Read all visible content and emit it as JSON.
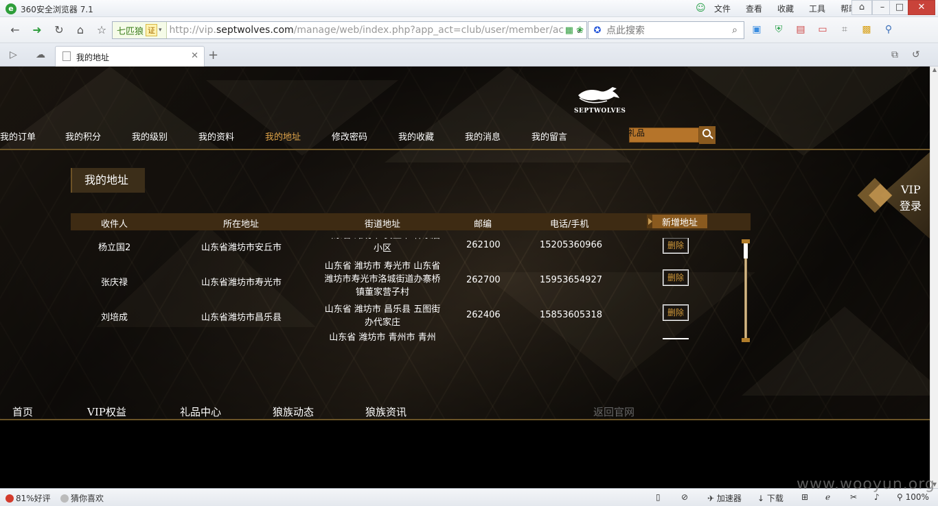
{
  "browser": {
    "title": "360安全浏览器 7.1",
    "menus": [
      "文件",
      "查看",
      "收藏",
      "工具",
      "帮助"
    ],
    "site_badge": "七匹狼",
    "cert_label": "证",
    "url_prefix": "http://vip.",
    "url_host": "septwolves.com",
    "url_path": "/manage/web/index.php?app_act=club/user/member/ac",
    "search_placeholder": "点此搜索",
    "tab_title": "我的地址",
    "icons": [
      "back-icon",
      "forward-icon",
      "refresh-icon",
      "home-icon",
      "star-icon",
      "search-icon",
      "close-icon",
      "add-tab-icon"
    ]
  },
  "site": {
    "brand": "SEPTWOLVES",
    "nav": [
      {
        "label": "我的订单",
        "active": false
      },
      {
        "label": "我的积分",
        "active": false
      },
      {
        "label": "我的级别",
        "active": false
      },
      {
        "label": "我的资料",
        "active": false
      },
      {
        "label": "我的地址",
        "active": true
      },
      {
        "label": "修改密码",
        "active": false
      },
      {
        "label": "我的收藏",
        "active": false
      },
      {
        "label": "我的消息",
        "active": false
      },
      {
        "label": "我的留言",
        "active": false
      }
    ],
    "gift_search_value": "礼品",
    "section_title": "我的地址",
    "vip_line1": "VIP",
    "vip_line2": "登录",
    "accent_color": "#e0a54a"
  },
  "address_table": {
    "headers": [
      "收件人",
      "所在地址",
      "街道地址",
      "邮编",
      "电话/手机"
    ],
    "add_button": "新增地址",
    "delete_label": "删除",
    "rows": [
      {
        "name": "杨立国2",
        "region": "山东省潍坊市安丘市",
        "street": "山东省 潍坊市 安丘市 韩家后小区",
        "zip": "262100",
        "phone": "15205360966"
      },
      {
        "name": "张庆禄",
        "region": "山东省潍坊市寿光市",
        "street": "山东省 潍坊市 寿光市 山东省潍坊市寿光市洛城街道办寨桥镇董家营子村",
        "zip": "262700",
        "phone": "15953654927"
      },
      {
        "name": "刘培成",
        "region": "山东省潍坊市昌乐县",
        "street": "山东省 潍坊市 昌乐县 五图街办代家庄",
        "zip": "262406",
        "phone": "15853605318"
      },
      {
        "name": "",
        "region": "",
        "street": "山东省 潍坊市 青州市 青州",
        "zip": "",
        "phone": ""
      }
    ]
  },
  "footer": {
    "links": [
      "首页",
      "VIP权益",
      "礼品中心",
      "狼族动态",
      "狼族资讯"
    ],
    "official": "返回官网"
  },
  "statusbar": {
    "rating": "81%好评",
    "guess": "猜你喜欢",
    "accelerator": "加速器",
    "download": "下载",
    "zoom": "100%"
  },
  "watermark": "www.wooyun.org"
}
